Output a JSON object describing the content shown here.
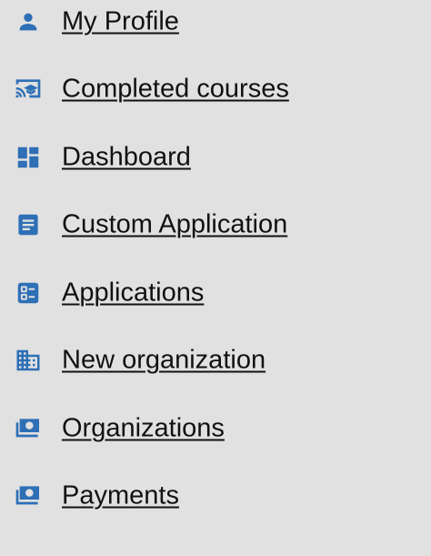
{
  "accent_color": "#2e6fb6",
  "menu": {
    "items": [
      {
        "label": "My Profile",
        "icon": "person-icon"
      },
      {
        "label": "Completed courses",
        "icon": "cast-education-icon"
      },
      {
        "label": "Dashboard",
        "icon": "dashboard-icon"
      },
      {
        "label": "Custom Application",
        "icon": "document-icon"
      },
      {
        "label": "Applications",
        "icon": "list-icon"
      },
      {
        "label": "New organization",
        "icon": "domain-icon"
      },
      {
        "label": "Organizations",
        "icon": "payments-icon"
      },
      {
        "label": "Payments",
        "icon": "payments-icon"
      }
    ]
  }
}
